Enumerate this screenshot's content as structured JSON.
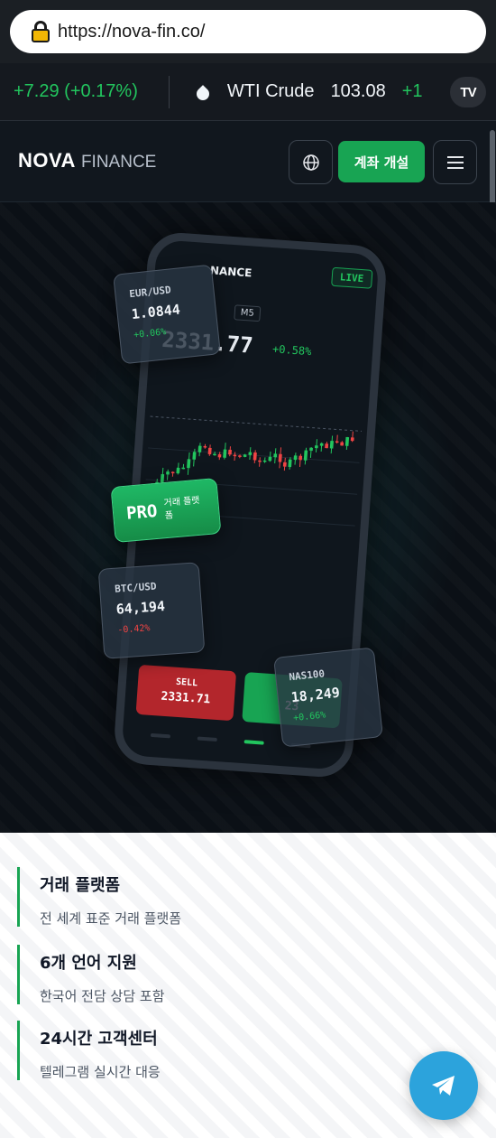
{
  "browser": {
    "url": "https://nova-fin.co/"
  },
  "ticker": {
    "prev_change": "+7.29 (+0.17%)",
    "item_name": "WTI Crude",
    "item_price": "103.08",
    "item_change": "+1",
    "badge": "TV"
  },
  "header": {
    "logo_bold": "NOVA",
    "logo_light": "FINANCE",
    "open_account": "계좌 개설"
  },
  "phone": {
    "title": "NANCE",
    "live": "LIVE",
    "timeframe": "M5",
    "price": "2331.77",
    "change": "+0.58%",
    "sell_label": "SELL",
    "sell_price": "2331.71",
    "buy_price": "23"
  },
  "cards": {
    "eur": {
      "symbol": "EUR/USD",
      "value": "1.0844",
      "change": "+0.06%"
    },
    "btc": {
      "symbol": "BTC/USD",
      "value": "64,194",
      "change": "-0.42%"
    },
    "nas": {
      "symbol": "NAS100",
      "value": "18,249",
      "change": "+0.66%"
    },
    "pro": {
      "label": "PRO",
      "sub": "거래 플랫폼"
    }
  },
  "features": [
    {
      "title": "거래 플랫폼",
      "desc": "전 세계 표준 거래 플랫폼"
    },
    {
      "title": "6개 언어 지원",
      "desc": "한국어 전담 상담 포함"
    },
    {
      "title": "24시간 고객센터",
      "desc": "텔레그램 실시간 대응"
    }
  ],
  "colors": {
    "accent": "#18a453",
    "up": "#22c55e",
    "down": "#ef4444",
    "telegram": "#2ca3dc"
  },
  "icons": [
    "lock-icon",
    "drop-icon",
    "globe-icon",
    "menu-icon",
    "telegram-icon"
  ]
}
